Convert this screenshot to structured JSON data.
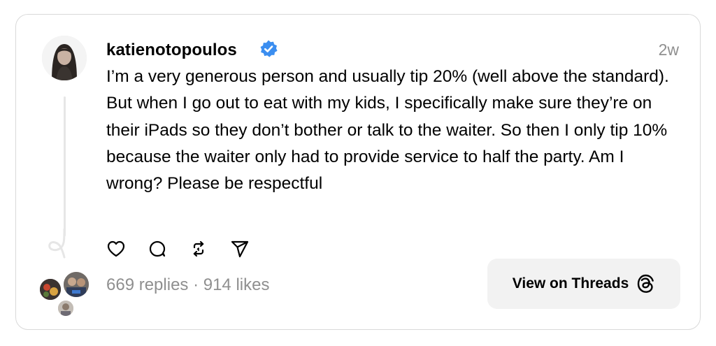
{
  "post": {
    "username": "katienotopoulos",
    "verified": true,
    "timestamp": "2w",
    "body": "I’m a very generous person and usually tip 20% (well above the standard). But when I go out to eat with my kids, I specifically make sure they’re on their iPads so they don’t bother or talk to the waiter. So then I only tip 10% because the waiter only had to provide service to half the party. Am I wrong? Please be respectful"
  },
  "actions": [
    {
      "name": "like",
      "icon": "heart-icon"
    },
    {
      "name": "reply",
      "icon": "speech-bubble-icon"
    },
    {
      "name": "repost",
      "icon": "repost-icon"
    },
    {
      "name": "share",
      "icon": "paper-plane-icon"
    }
  ],
  "footer": {
    "stats": "669 replies · 914 likes",
    "view_button_label": "View on Threads",
    "view_button_icon": "threads-logo-icon"
  },
  "colors": {
    "verified_badge": "#3b8ef0",
    "muted_text": "#8f8f8f",
    "button_bg": "#f2f2f2",
    "card_border": "#d9d9d9"
  }
}
